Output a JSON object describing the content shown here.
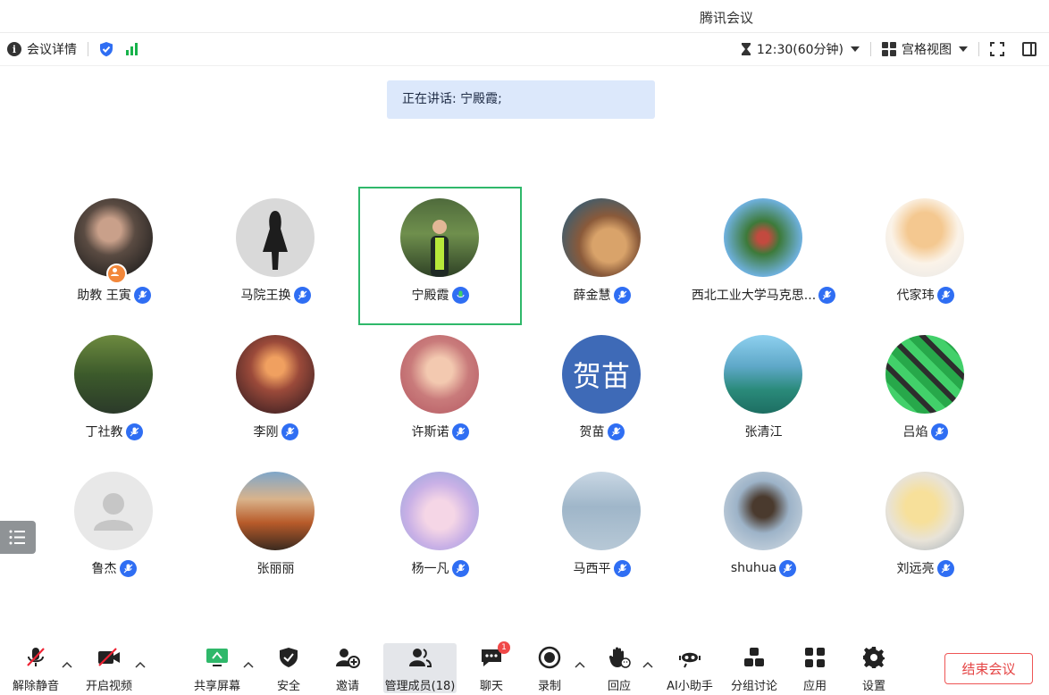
{
  "window": {
    "title": "腾讯会议"
  },
  "toolbar": {
    "meeting_info": "会议详情",
    "timer": "12:30(60分钟)",
    "view_mode": "宫格视图"
  },
  "speaking": {
    "text": "正在讲话: 宁殿霞;"
  },
  "participants": [
    {
      "name": "助教 王寅"
    },
    {
      "name": "马院王换"
    },
    {
      "name": "宁殿霞"
    },
    {
      "name": "薛金慧"
    },
    {
      "name": "西北工业大学马克思..."
    },
    {
      "name": "代家玮"
    },
    {
      "name": "丁社教"
    },
    {
      "name": "李刚"
    },
    {
      "name": "许斯诺"
    },
    {
      "name": "贺苗",
      "avatar_text": "贺苗"
    },
    {
      "name": "张清江"
    },
    {
      "name": "吕焰"
    },
    {
      "name": "鲁杰"
    },
    {
      "name": "张丽丽"
    },
    {
      "name": "杨一凡"
    },
    {
      "name": "马西平"
    },
    {
      "name": "shuhua"
    },
    {
      "name": "刘远亮"
    }
  ],
  "bottom_bar": {
    "unmute": "解除静音",
    "start_video": "开启视频",
    "share_screen": "共享屏幕",
    "security": "安全",
    "invite": "邀请",
    "manage_members": "管理成员(18)",
    "chat": "聊天",
    "chat_badge": "1",
    "record": "录制",
    "react": "回应",
    "ai_assistant": "AI小助手",
    "breakout": "分组讨论",
    "apps": "应用",
    "settings": "设置",
    "end_meeting": "结束会议"
  },
  "colors": {
    "accent": "#2f6ef3",
    "active_speaker": "#2fb86a",
    "end": "#e54545",
    "signal": "#17b24a"
  }
}
